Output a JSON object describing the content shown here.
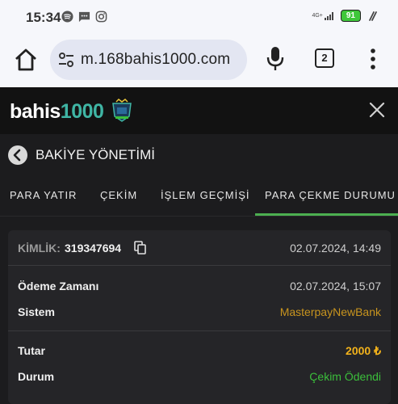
{
  "status_bar": {
    "time": "15:34",
    "network": "4G+",
    "battery": "91"
  },
  "browser": {
    "url": "m.168bahis1000.com",
    "tab_count": "2"
  },
  "site": {
    "logo_main": "bahis",
    "logo_accent": "1000"
  },
  "page": {
    "title": "BAKİYE YÖNETİMİ"
  },
  "tabs": [
    {
      "label": "PARA YATIR",
      "active": false
    },
    {
      "label": "ÇEKİM",
      "active": false
    },
    {
      "label": "İŞLEM GEÇMİŞİ",
      "active": false
    },
    {
      "label": "PARA ÇEKME DURUMU",
      "active": true
    }
  ],
  "withdrawal": {
    "id_label": "KİMLİK:",
    "id_value": "319347694",
    "created_at": "02.07.2024, 14:49",
    "rows": [
      {
        "label": "Ödeme Zamanı",
        "value": "02.07.2024, 15:07",
        "color": "#cfcfcf"
      },
      {
        "label": "Sistem",
        "value": "MasterpayNewBank",
        "color": "#c8941e"
      },
      {
        "label": "Tutar",
        "value": "2000 ₺",
        "color": "#f2b21b"
      },
      {
        "label": "Durum",
        "value": "Çekim Ödendi",
        "color": "#3bbf3b"
      }
    ]
  },
  "colors": {
    "accent_green": "#4caf50",
    "background": "#1c1c1e",
    "card": "#252528"
  }
}
